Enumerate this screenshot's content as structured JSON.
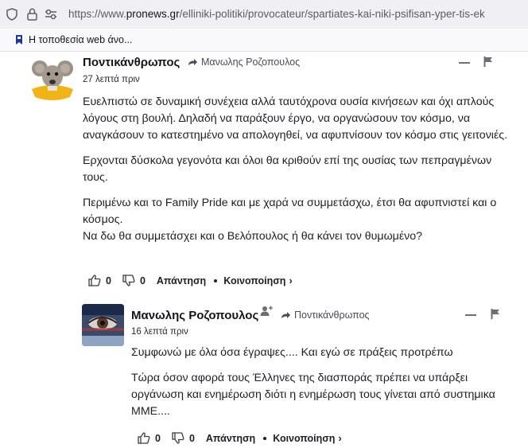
{
  "browser": {
    "url_prefix": "https://www.",
    "url_host": "pronews.gr",
    "url_path": "/elliniki-politiki/provocateur/spartiates-kai-niki-psifisan-yper-tis-ek",
    "bookmark_label": "Η τοποθεσία web άνο..."
  },
  "comments": [
    {
      "author": "Ποντικάνθρωπος",
      "reply_to": "Μανωλης Ροζοπουλος",
      "time": "27 λεπτά πριν",
      "paragraphs": [
        "Ευελπιστώ σε δυναμική συνέχεια αλλά ταυτόχρονα ουσία κινήσεων και όχι απλούς λόγους στη βουλή. Δηλαδή να παράξουν έργο, να οργανώσουν τον κόσμο, να αναγκάσουν το κατεστημένο να απολογηθεί, να αφυπνίσουν τον κόσμο στις γειτονιές.",
        "Ερχονται δύσκολα γεγονότα και όλοι θα κριθούν επί της ουσίας των πεπραγμένων τους.",
        "Περιμένω και το Family Pride και με χαρά να συμμετάσχω, έτσι θα αφυπνιστεί και ο κόσμος.\nΝα δω θα συμμετάσχει και ο Βελόπουλος ή θα κάνει τον θυμωμένο?"
      ],
      "likes": "0",
      "dislikes": "0",
      "reply_label": "Απάντηση",
      "share_label": "Κοινοποίηση",
      "share_chevron": "›"
    },
    {
      "author": "Μανωλης Ροζοπουλος",
      "reply_to": "Ποντικάνθρωπος",
      "time": "16 λεπτά πριν",
      "paragraphs": [
        "Συμφωνώ με όλα όσα έγραψες.... Και εγώ σε πράξεις προτρέπω",
        "Τώρα όσον αφορά τους Έλληνες της διασποράς πρέπει να υπάρξει οργάνωση και ενημέρωση διότι η ενημέρωση τους γίνεται από συστημικα ΜΜΕ...."
      ],
      "likes": "0",
      "dislikes": "0",
      "reply_label": "Απάντηση",
      "share_label": "Κοινοποίηση",
      "share_chevron": "›"
    }
  ],
  "icons": {
    "shield": "shield-icon",
    "lock": "lock-icon",
    "permissions": "permissions-icon",
    "bookmark": "bookmark-favicon",
    "reply_arrow": "reply-arrow-icon",
    "collapse": "collapse-icon",
    "flag": "flag-icon",
    "thumbs_up": "thumbs-up-icon",
    "thumbs_down": "thumbs-down-icon",
    "follow": "follow-user-icon"
  },
  "colors": {
    "urlbar_bg": "#f0f0f4",
    "bookmarks_bg": "#f9f9fb",
    "text": "#15141a",
    "muted": "#4a4a55"
  }
}
